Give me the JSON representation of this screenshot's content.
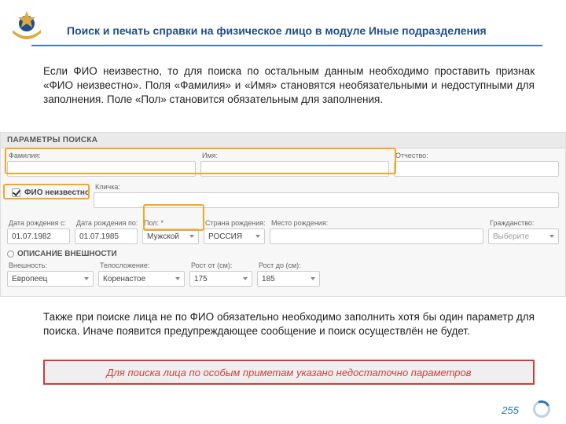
{
  "title": "Поиск и печать справки на физическое лицо в модуле Иные подразделения",
  "intro": "Если ФИО неизвестно, то для поиска по остальным данным необходимо проставить признак «ФИО неизвестно». Поля «Фамилия» и «Имя» становятся необязательными и недоступными для заполнения. Поле «Пол» становится обязательным для заполнения.",
  "form": {
    "header": "ПАРАМЕТРЫ ПОИСКА",
    "labels": {
      "surname": "Фамилия:",
      "name": "Имя:",
      "patronymic": "Отчество:",
      "nickname": "Кличка:",
      "unknown_fio": "ФИО неизвестно",
      "date_from": "Дата рождения с:",
      "date_to": "Дата рождения по:",
      "sex": "Пол: *",
      "birth_country": "Страна рождения:",
      "birth_place": "Место рождения:",
      "citizenship": "Гражданство:",
      "appearance_section": "ОПИСАНИЕ ВНЕШНОСТИ",
      "appearance": "Внешность:",
      "build": "Телосложение:",
      "height_from": "Рост от (см):",
      "height_to": "Рост до (см):"
    },
    "values": {
      "date_from": "01.07.1982",
      "date_to": "01.07.1985",
      "sex": "Мужской",
      "birth_country": "РОССИЯ",
      "citizenship": "Выберите",
      "appearance": "Европеец",
      "build": "Коренастое",
      "height_from": "175",
      "height_to": "185"
    }
  },
  "outro": "Также при поиске лица не по ФИО обязательно необходимо заполнить хотя бы один параметр для поиска. Иначе появится предупреждающее сообщение и поиск осуществлён не будет.",
  "warning": "Для поиска лица по особым приметам указано недостаточно параметров",
  "page_number": "255"
}
